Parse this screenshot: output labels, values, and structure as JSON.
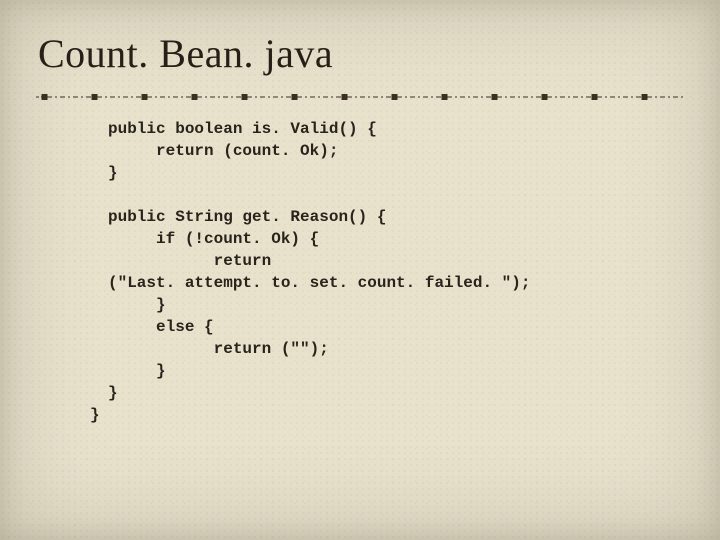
{
  "title": "Count. Bean. java",
  "code": {
    "block1_l1": "public boolean is. Valid() {",
    "block1_l2": "     return (count. Ok);",
    "block1_l3": "}",
    "block2_l1": "public String get. Reason() {",
    "block2_l2": "     if (!count. Ok) {",
    "block2_l3": "           return",
    "block2_l4": "(\"Last. attempt. to. set. count. failed. \");",
    "block2_l5": "     }",
    "block2_l6": "     else {",
    "block2_l7": "           return (\"\");",
    "block2_l8": "     }",
    "block2_l9": "}",
    "close": "}"
  },
  "colors": {
    "background": "#e8e2cd",
    "text": "#261f17",
    "divider": "#3b2f22"
  }
}
